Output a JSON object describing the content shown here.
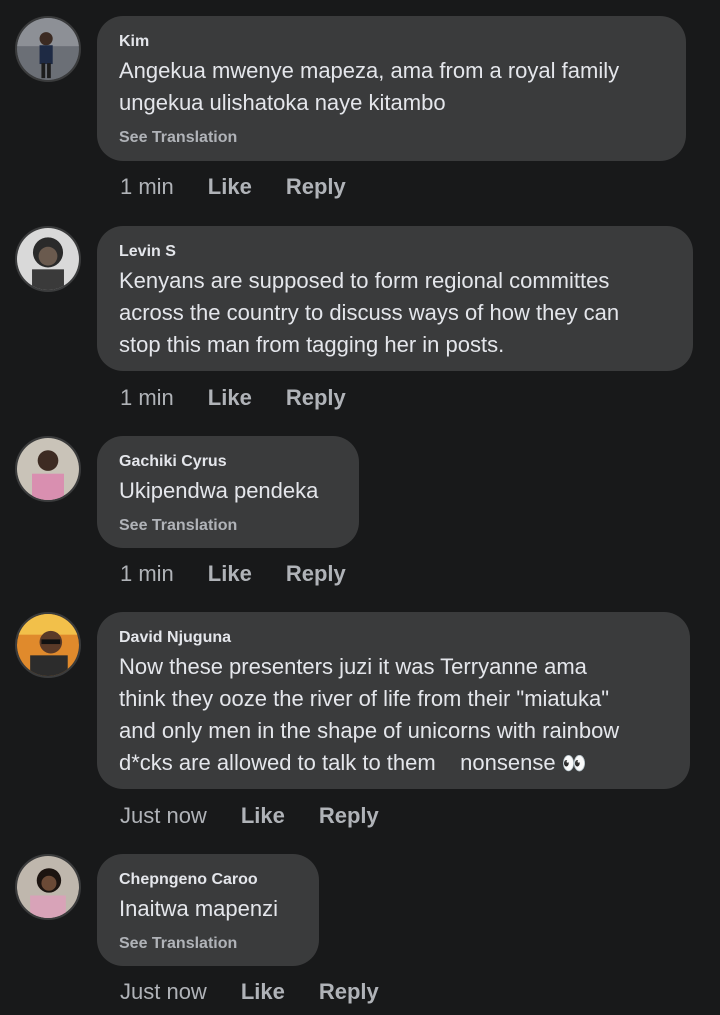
{
  "comments": [
    {
      "author": "Kim",
      "lines": [
        "Angekua mwenye mapeza, ama from a royal family",
        "ungekua ulishatoka naye kitambo"
      ],
      "translation": "See Translation",
      "time": "1 min",
      "like": "Like",
      "reply": "Reply"
    },
    {
      "author": "Levin S",
      "lines": [
        "Kenyans are supposed to form regional committes",
        "across the country to discuss ways of how they can",
        "stop this man from tagging her in posts."
      ],
      "time": "1 min",
      "like": "Like",
      "reply": "Reply"
    },
    {
      "author": "Gachiki Cyrus",
      "lines": [
        "Ukipendwa pendeka"
      ],
      "translation": "See Translation",
      "time": "1 min",
      "like": "Like",
      "reply": "Reply"
    },
    {
      "author": "David Njuguna",
      "lines": [
        "Now these presenters juzi it was Terryanne ama",
        "think they ooze the river of life from their \"miatuka\"",
        "and only men in the shape of unicorns with rainbow",
        "d*cks are allowed to talk to them    nonsense"
      ],
      "emoji": "👀",
      "time": "Just now",
      "like": "Like",
      "reply": "Reply"
    },
    {
      "author": "Chepngeno Caroo",
      "lines": [
        "Inaitwa mapenzi"
      ],
      "translation": "See Translation",
      "time": "Just now",
      "like": "Like",
      "reply": "Reply"
    }
  ]
}
